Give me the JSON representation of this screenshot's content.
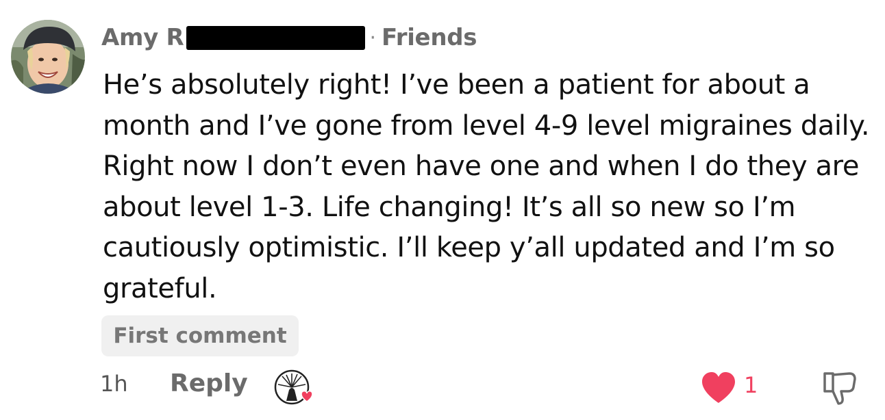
{
  "comment": {
    "author_visible_name": "Amy R",
    "separator": "·",
    "relation": "Friends",
    "text": "He’s absolutely right! I’ve been a patient for about a month and I’ve gone from level 4-9 level migraines daily. Right now I don’t even have one and when I do they are about level 1-3. Life changing! It’s all so new so I’m cautiously optimistic. I’ll keep y’all updated and I’m so grateful.",
    "badge": "First comment",
    "timestamp": "1h",
    "reply_label": "Reply",
    "like_count": "1"
  },
  "icons": {
    "avatar": "profile-photo",
    "reactor": "tree-avatar-with-heart",
    "like": "heart-icon",
    "dislike": "thumbs-down-icon"
  },
  "colors": {
    "like_red": "#f0405f",
    "muted_text": "#6b6b6b",
    "badge_bg": "#f0f0f0"
  }
}
